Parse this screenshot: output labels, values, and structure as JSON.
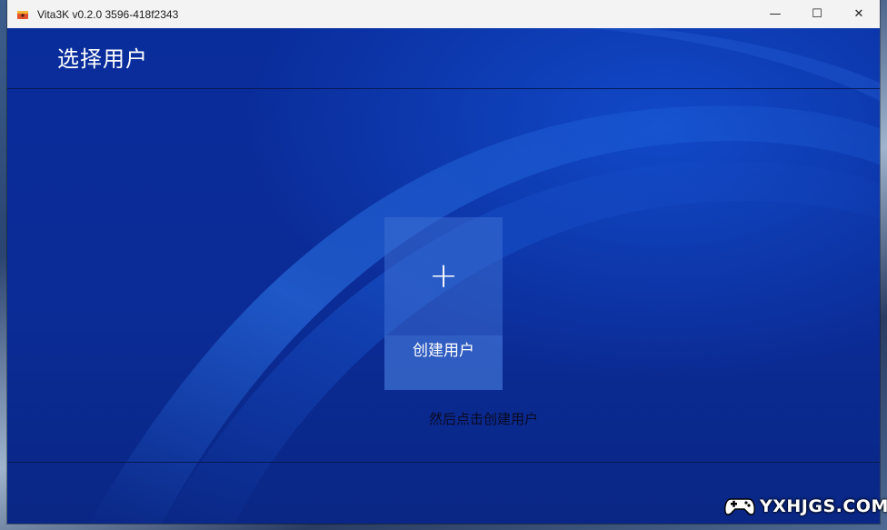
{
  "window": {
    "title": "Vita3K v0.2.0 3596-418f2343",
    "controls": {
      "minimize_glyph": "—",
      "maximize_glyph": "☐",
      "close_glyph": "✕"
    }
  },
  "header": {
    "title": "选择用户"
  },
  "create_card": {
    "icon": "plus-icon",
    "plus_glyph": "+",
    "label": "创建用户"
  },
  "hint": {
    "text": "然后点击创建用户"
  },
  "watermark": {
    "text": "YXHJGS.COM",
    "icon": "gamepad-icon"
  },
  "colors": {
    "background_blue": "#0d2fa0",
    "card": "#3c6ed2",
    "titlebar": "#f3f3f3"
  }
}
